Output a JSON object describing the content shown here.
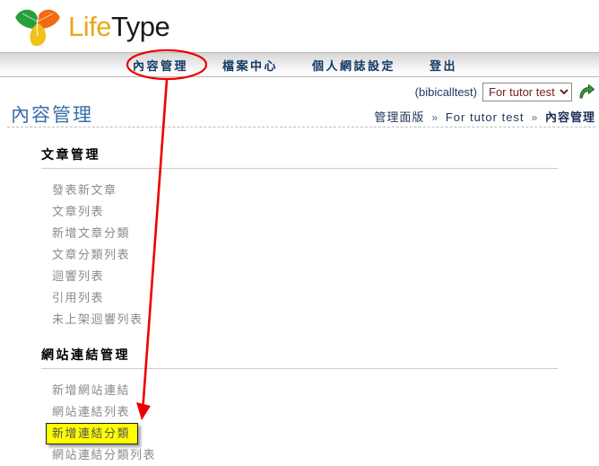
{
  "brand": {
    "logo_life": "Life",
    "logo_type": "Type",
    "logo_icon": "three-leaf-icon",
    "life_color": "#E8A81C",
    "type_color": "#1A1A1A"
  },
  "nav": {
    "items": [
      {
        "label": "內容管理",
        "name": "nav-content-management"
      },
      {
        "label": "檔案中心",
        "name": "nav-file-center"
      },
      {
        "label": "個人網誌設定",
        "name": "nav-blog-settings"
      },
      {
        "label": "登出",
        "name": "nav-logout"
      }
    ]
  },
  "user_bar": {
    "username": "(bibicalltest)",
    "blog_selected": "For tutor test",
    "blog_options": [
      "For tutor test"
    ],
    "go_icon": "green-go-arrow-icon"
  },
  "page": {
    "title": "內容管理"
  },
  "breadcrumb": {
    "root": "管理面版",
    "separator": "»",
    "blog": "For tutor test",
    "current": "內容管理"
  },
  "sections": [
    {
      "header": "文章管理",
      "items": [
        {
          "label": "發表新文章",
          "highlighted": false
        },
        {
          "label": "文章列表",
          "highlighted": false
        },
        {
          "label": "新增文章分類",
          "highlighted": false
        },
        {
          "label": "文章分類列表",
          "highlighted": false
        },
        {
          "label": "迴響列表",
          "highlighted": false
        },
        {
          "label": "引用列表",
          "highlighted": false
        },
        {
          "label": "未上架迴響列表",
          "highlighted": false
        }
      ]
    },
    {
      "header": "網站連結管理",
      "items": [
        {
          "label": "新增網站連結",
          "highlighted": false
        },
        {
          "label": "網站連結列表",
          "highlighted": false
        },
        {
          "label": "新增連結分類",
          "highlighted": true
        },
        {
          "label": "網站連結分類列表",
          "highlighted": false
        }
      ]
    }
  ],
  "annotations": {
    "color": "#ee0000",
    "ellipse_target": "內容管理",
    "arrow_target": "新增連結分類"
  }
}
